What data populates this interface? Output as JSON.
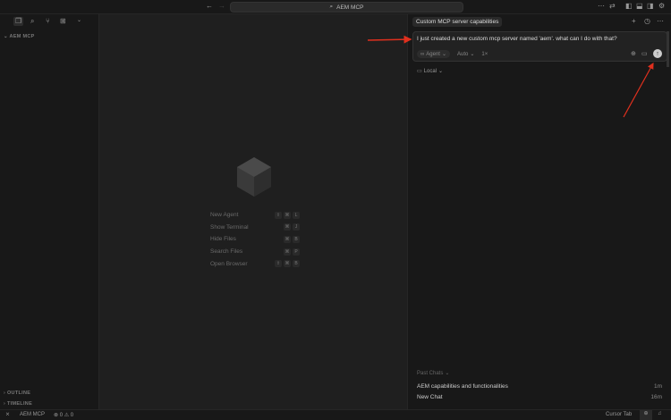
{
  "topbar": {
    "search_text": "AEM MCP"
  },
  "sidebar": {
    "section": "AEM MCP",
    "outline": "OUTLINE",
    "timeline": "TIMELINE"
  },
  "editor": {
    "shortcuts": [
      {
        "label": "New Agent",
        "keys": [
          "⇧",
          "⌘",
          "L"
        ]
      },
      {
        "label": "Show Terminal",
        "keys": [
          "⌘",
          "J"
        ]
      },
      {
        "label": "Hide Files",
        "keys": [
          "⌘",
          "B"
        ]
      },
      {
        "label": "Search Files",
        "keys": [
          "⌘",
          "P"
        ]
      },
      {
        "label": "Open Browser",
        "keys": [
          "⇧",
          "⌘",
          "B"
        ]
      }
    ]
  },
  "panel": {
    "tab_title": "Custom MCP server capabilities",
    "message": "I just created a new custom mcp server named 'aem'. what can I do with that?",
    "mode": "Agent",
    "model": "Auto",
    "multiplier": "1×",
    "location": "Local",
    "past_chats_label": "Past Chats",
    "past_chats": [
      {
        "title": "AEM capabilities and functionalities",
        "time": "1m"
      },
      {
        "title": "New Chat",
        "time": "16m"
      }
    ]
  },
  "status": {
    "project": "AEM MCP",
    "errors": "0",
    "warnings": "0",
    "cursor_tab": "Cursor Tab"
  },
  "colors": {
    "annotation": "#e0301e"
  }
}
